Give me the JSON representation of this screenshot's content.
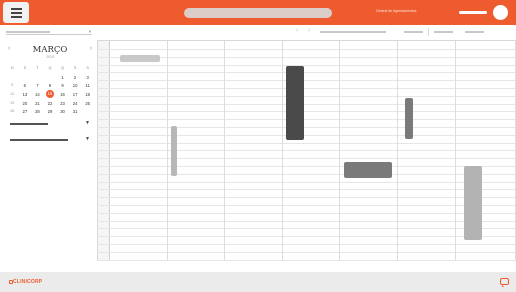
{
  "header": {
    "menu_icon": "hamburger-icon",
    "link_label": "Central de Agendamentos",
    "brand_color": "#ee5b2f"
  },
  "calendar": {
    "month": "MARÇO",
    "year": "2019",
    "prev_icon": "chevron-left-icon",
    "next_icon": "chevron-right-icon",
    "weekday_headers": [
      "D",
      "S",
      "T",
      "Q",
      "Q",
      "S",
      "S"
    ],
    "weeks": [
      {
        "wk": "",
        "days": [
          "",
          "",
          "",
          "",
          "1",
          "2"
        ]
      },
      {
        "wk": "",
        "days": [
          "3",
          "4",
          "5",
          "6",
          "7",
          "8",
          "9"
        ]
      },
      {
        "wk": "",
        "days": [
          "10",
          "11",
          "12",
          "13",
          "14",
          "15",
          "16"
        ]
      },
      {
        "wk": "",
        "days": [
          "17",
          "18",
          "19",
          "20",
          "21",
          "22",
          "23"
        ]
      },
      {
        "wk": "",
        "days": [
          "24",
          "25",
          "26",
          "27",
          "28",
          "29",
          "30"
        ]
      },
      {
        "wk": "",
        "days": [
          "31"
        ]
      }
    ],
    "row_labels": [
      "9",
      "10",
      "11",
      "12",
      "13"
    ],
    "grid_rows": [
      [
        "",
        "",
        "",
        "",
        "1",
        "2",
        "3",
        "4"
      ],
      [
        "9",
        "10",
        "11",
        "12",
        "13",
        "14",
        "15",
        "16"
      ],
      [
        "16",
        "17",
        "18",
        "19",
        "20",
        "21",
        "22",
        "23"
      ],
      [
        "23",
        "24",
        "25",
        "26",
        "27",
        "28",
        "29",
        "30"
      ],
      [
        "30",
        "31",
        "",
        "",
        "",
        "",
        "",
        ""
      ]
    ],
    "display_rows": [
      [
        "D",
        "S",
        "T",
        "Q",
        "Q",
        "S",
        "S"
      ],
      [
        "",
        "",
        "",
        "",
        "1",
        "2",
        "3",
        "4"
      ],
      [
        "9",
        "6",
        "7",
        "8",
        "9",
        "10",
        "11"
      ],
      [
        "10",
        "13",
        "14",
        "15",
        "16",
        "17",
        "18"
      ],
      [
        "11",
        "20",
        "21",
        "22",
        "23",
        "24",
        "25"
      ],
      [
        "12",
        "27",
        "28",
        "29",
        "30",
        "31",
        ""
      ],
      [
        "13",
        "",
        "",
        "",
        "",
        "",
        ""
      ]
    ],
    "today": "15"
  },
  "footer": {
    "logo_text": "CLINICORP",
    "chat_icon": "chat-icon"
  }
}
